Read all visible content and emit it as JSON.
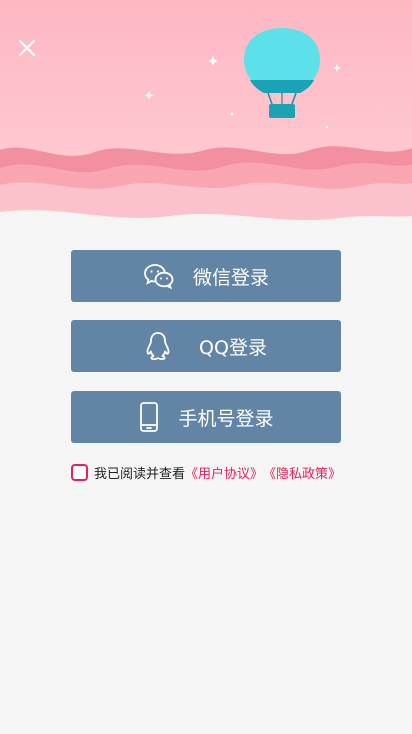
{
  "header": {
    "close_icon": "close-icon",
    "balloon_icon": "hot-air-balloon",
    "colors": {
      "sky_top": "#fdb7c2",
      "sky_bottom": "#ffd0d6",
      "waves_dark": "#f28fa0",
      "waves_mid": "#f9a6b2",
      "waves_light": "#fcc2cb",
      "balloon": "#5ce1ea",
      "balloon_band": "#18a5b8",
      "basket": "#1aa3b4"
    }
  },
  "buttons": {
    "wechat_label": "微信登录",
    "wechat_icon": "wechat-icon",
    "qq_label": "QQ登录",
    "qq_icon": "qq-penguin-icon",
    "phone_label": "手机号登录",
    "phone_icon": "mobile-phone-icon",
    "background": "#6385a5"
  },
  "agreement": {
    "prefix": "我已阅读并查看",
    "user_agreement": "《用户协议》",
    "privacy_policy": "《隐私政策》",
    "checked": false,
    "accent": "#e5205a"
  }
}
